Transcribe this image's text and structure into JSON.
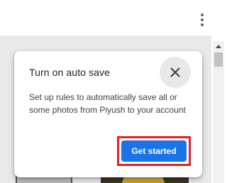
{
  "toolbar": {
    "more_icon": "more-vert-icon"
  },
  "dialog": {
    "title": "Turn on auto save",
    "close_icon": "close-icon",
    "body": "Set up rules to automatically save all or some photos from Piyush to your account",
    "primary_button_label": "Get started",
    "highlight_color": "#e0222c",
    "button_color": "#1a73e8"
  }
}
